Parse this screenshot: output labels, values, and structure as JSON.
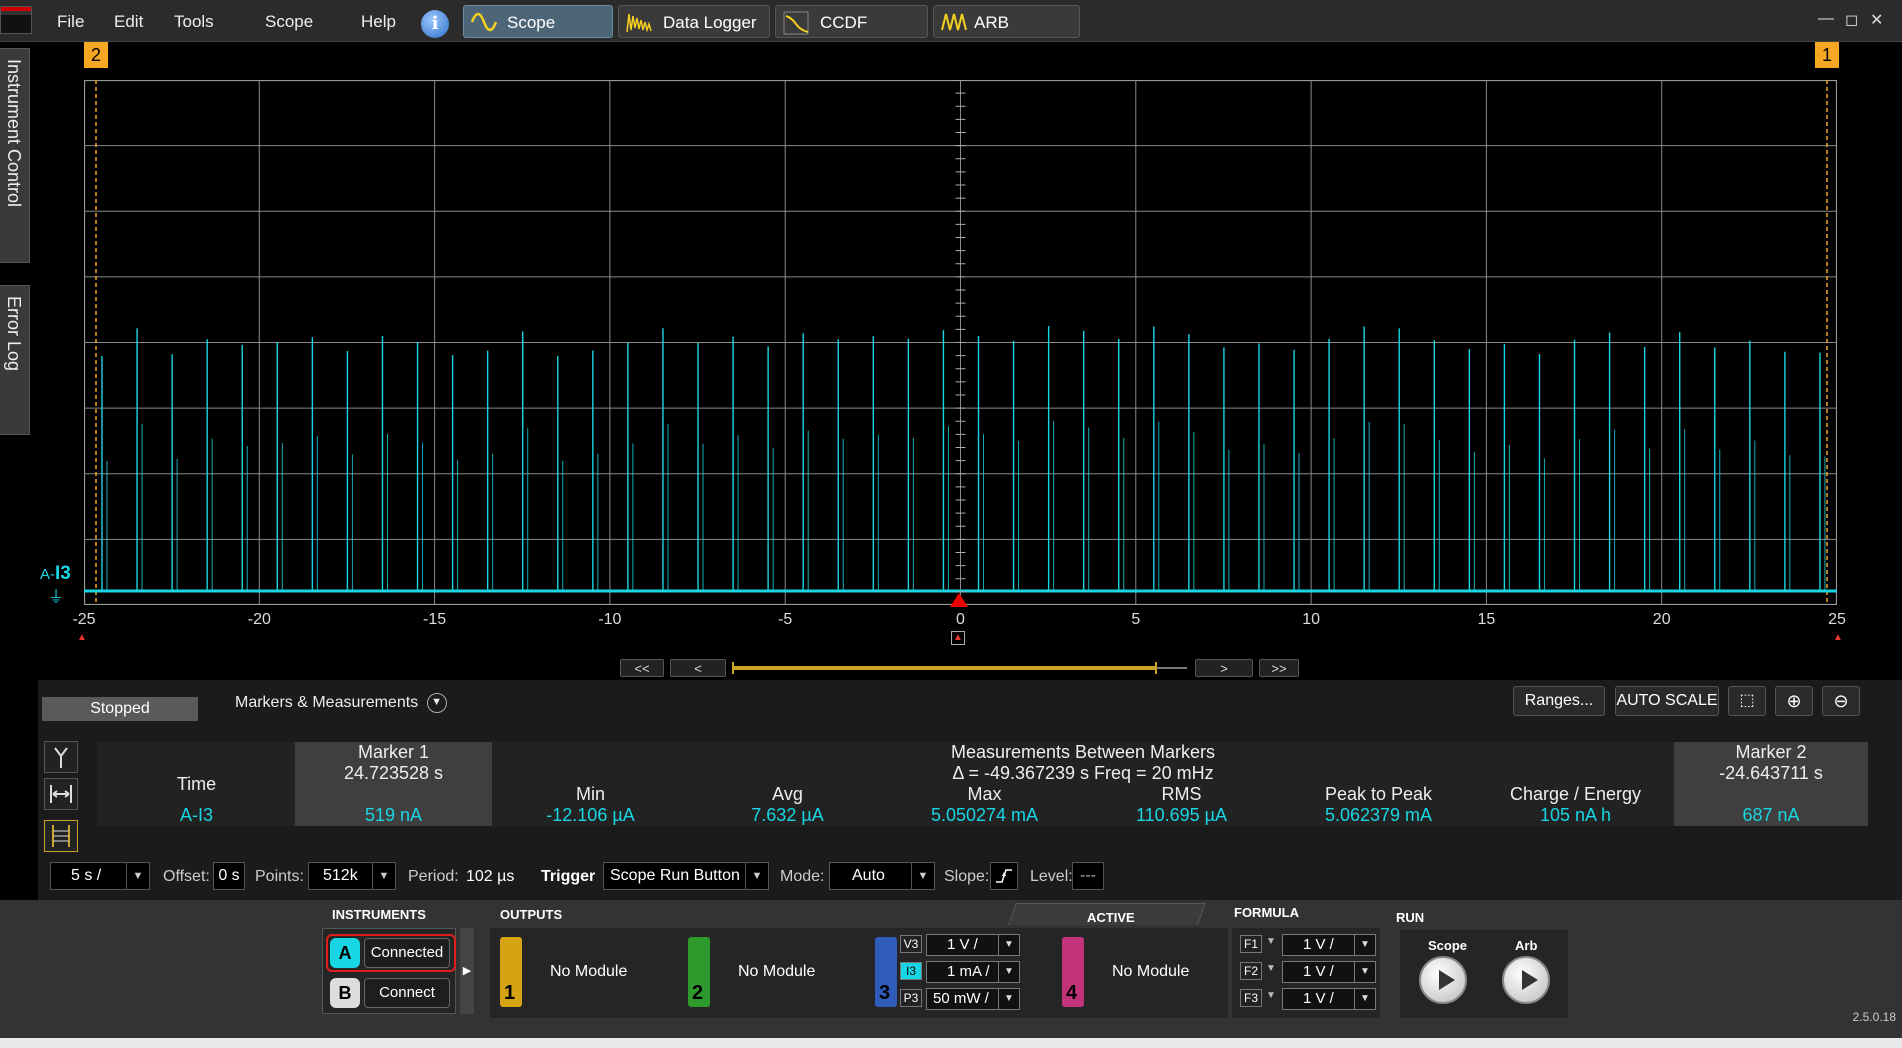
{
  "menu": [
    "File",
    "Edit",
    "Tools",
    "Scope",
    "Help"
  ],
  "tabs": [
    "Scope",
    "Data Logger",
    "CCDF",
    "ARB"
  ],
  "window_controls": [
    "—",
    "◻",
    "✕"
  ],
  "side_tabs": [
    "Instrument Control",
    "Error Log"
  ],
  "plot": {
    "x_ticks": [
      "-25",
      "-20",
      "-15",
      "-10",
      "-5",
      "0",
      "5",
      "10",
      "15",
      "20",
      "25"
    ],
    "channel_label_prefix": "A-",
    "channel_label": "I3",
    "marker1_flag": "1",
    "marker2_flag": "2",
    "trace_color": "#19d6e4",
    "marker_color": "#f5a623"
  },
  "nav": [
    "<<",
    "<",
    ">",
    ">>"
  ],
  "measurements": {
    "status": "Stopped",
    "title": "Markers & Measurements",
    "ranges_button": "Ranges...",
    "autoscale_button": "AUTO SCALE",
    "marker1_header": "Marker 1",
    "between_header": "Measurements Between Markers",
    "marker2_header": "Marker 2",
    "time_label": "Time",
    "marker1_time": "24.723528 s",
    "delta": "Δ = -49.367239 s   Freq = 20 mHz",
    "marker2_time": "-24.643711 s",
    "columns": [
      "Min",
      "Avg",
      "Max",
      "RMS",
      "Peak to Peak",
      "Charge / Energy"
    ],
    "channel": "A-I3",
    "marker1_value": "519 nA",
    "values": [
      "-12.106 µA",
      "7.632 µA",
      "5.050274 mA",
      "110.695 µA",
      "5.062379 mA",
      "105 nA h"
    ],
    "marker2_value": "687 nA"
  },
  "timebase": {
    "scale": "5 s /",
    "offset_label": "Offset:",
    "offset": "0 s",
    "points_label": "Points:",
    "points": "512k",
    "period_label": "Period:",
    "period": "102 µs",
    "trigger_label": "Trigger",
    "trigger": "Scope Run Button",
    "mode_label": "Mode:",
    "mode": "Auto",
    "slope_label": "Slope:",
    "level_label": "Level:",
    "level": "---"
  },
  "bottom": {
    "instruments_title": "INSTRUMENTS",
    "inst_a": "A",
    "inst_a_status": "Connected",
    "inst_b": "B",
    "inst_b_status": "Connect",
    "outputs_title": "OUTPUTS",
    "active_title": "ACTIVE",
    "formula_title": "FORMULA",
    "run_title": "RUN",
    "outputs": [
      {
        "num": "1",
        "label": "No Module",
        "color": "#d6a313"
      },
      {
        "num": "2",
        "label": "No Module",
        "color": "#2e9a2e"
      },
      {
        "num": "3",
        "color": "#2f5cb8"
      },
      {
        "num": "4",
        "label": "No Module",
        "color": "#c2337a"
      }
    ],
    "ch3_ranges": [
      {
        "tag": "V3",
        "value": "1 V /"
      },
      {
        "tag": "I3",
        "value": "1 mA /"
      },
      {
        "tag": "P3",
        "value": "50 mW /"
      }
    ],
    "formulas": [
      {
        "tag": "F1",
        "value": "1 V /"
      },
      {
        "tag": "F2",
        "value": "1 V /"
      },
      {
        "tag": "F3",
        "value": "1 V /"
      }
    ],
    "run_scope": "Scope",
    "run_arb": "Arb",
    "version": "2.5.0.18"
  }
}
